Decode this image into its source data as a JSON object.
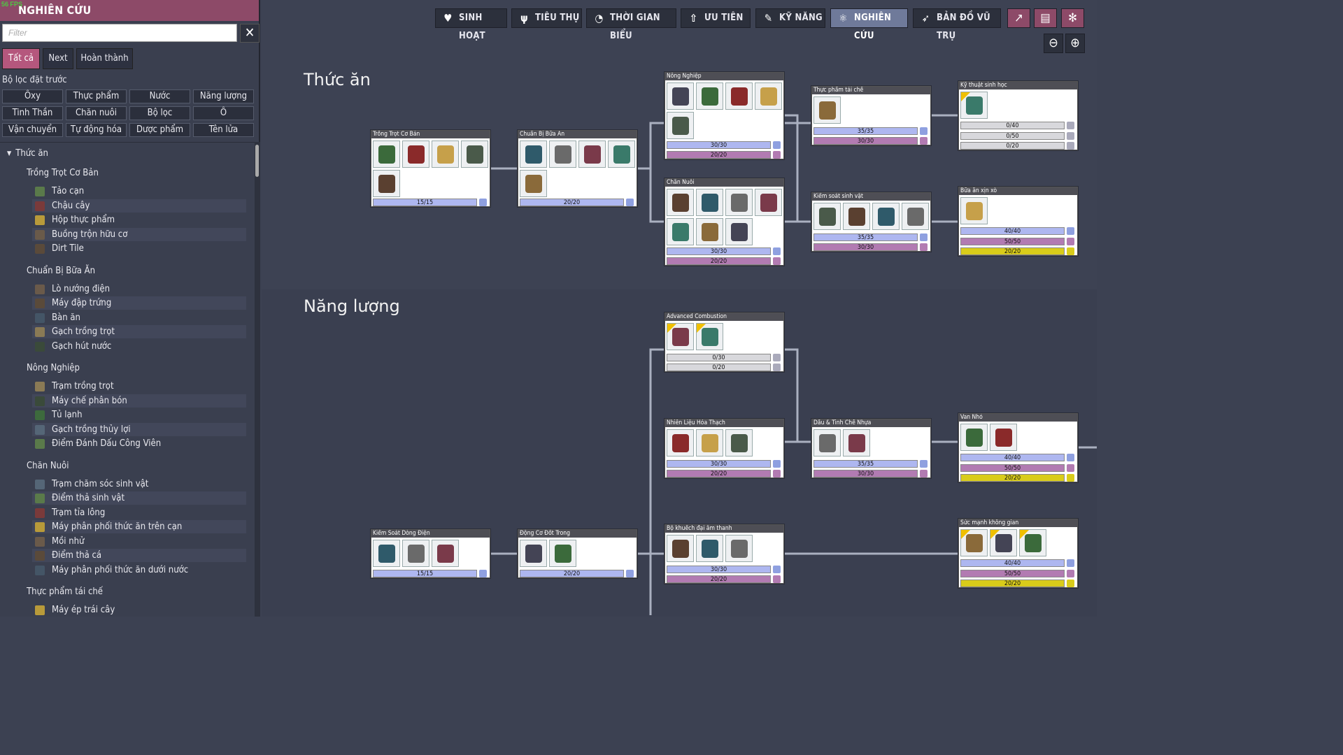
{
  "fps": "56 FPS",
  "sidebar": {
    "title": "NGHIÊN CỨU",
    "filter_placeholder": "Filter",
    "clear_label": "✕",
    "tabs": [
      "Tất cả",
      "Next",
      "Hoàn thành"
    ],
    "preset_label": "Bộ lọc đặt trước",
    "presets": [
      "Ôxy",
      "Thực phẩm",
      "Nước",
      "Năng lượng",
      "Tinh Thần",
      "Chăn nuôi",
      "Bộ lọc",
      "Ô",
      "Vận chuyển",
      "Tự động hóa",
      "Dược phẩm",
      "Tên lửa"
    ],
    "category": "Thức ăn",
    "groups": [
      {
        "name": "Trồng Trọt Cơ Bản",
        "items": [
          "Tảo cạn",
          "Chậu cây",
          "Hộp thực phẩm",
          "Buồng trộn hữu cơ",
          "Dirt Tile"
        ]
      },
      {
        "name": "Chuẩn Bị Bữa Ăn",
        "items": [
          "Lò nướng điện",
          "Máy đập trứng",
          "Bàn ăn",
          "Gạch trồng trọt",
          "Gạch hút nước"
        ]
      },
      {
        "name": "Nông Nghiệp",
        "items": [
          "Trạm trồng trọt",
          "Máy chế phân bón",
          "Tủ lạnh",
          "Gạch trồng thủy lợi",
          "Điểm Đánh Dấu Công Viên"
        ]
      },
      {
        "name": "Chăn Nuôi",
        "items": [
          "Trạm chăm sóc sinh vật",
          "Điểm thả sinh vật",
          "Trạm tỉa lông",
          "Máy phân phối thức ăn trên cạn",
          "Mồi nhử",
          "Điểm thả cá",
          "Máy phân phối thức ăn dưới nước"
        ]
      },
      {
        "name": "Thực phẩm tái chế",
        "items": [
          "Máy ép trái cây"
        ]
      }
    ]
  },
  "toolbar": {
    "buttons": [
      {
        "label": "SINH HOẠT",
        "icon": "heart-icon"
      },
      {
        "label": "TIÊU THỤ",
        "icon": "fork-knife-icon"
      },
      {
        "label": "THỜI GIAN BIỂU",
        "icon": "stopwatch-icon"
      },
      {
        "label": "ƯU TIÊN",
        "icon": "priority-arrow-icon"
      },
      {
        "label": "KỸ NĂNG",
        "icon": "wrench-icon"
      },
      {
        "label": "NGHIÊN CỨU",
        "icon": "research-atom-icon",
        "active": true
      },
      {
        "label": "BẢN ĐỒ VŨ TRỤ",
        "icon": "rocket-icon"
      }
    ],
    "icon_buttons": [
      "chart-icon",
      "book-icon",
      "gear-icon"
    ],
    "zoom": [
      "zoom-out-icon",
      "zoom-in-icon"
    ]
  },
  "sections": [
    "Thức ăn",
    "Năng lượng"
  ],
  "colors": {
    "accent": "#8d4a68",
    "bar_blue": "#aeb7f0",
    "bar_purple": "#b27bb2",
    "bar_yellow": "#d9cc1a"
  },
  "cards": [
    {
      "title": "Trồng Trọt Cơ Bản",
      "bars": [
        {
          "text": "15/15",
          "color": "blue"
        }
      ]
    },
    {
      "title": "Chuẩn Bị Bữa Ăn",
      "bars": [
        {
          "text": "20/20",
          "color": "blue"
        }
      ]
    },
    {
      "title": "Nông Nghiệp",
      "bars": [
        {
          "text": "30/30",
          "color": "blue"
        },
        {
          "text": "20/20",
          "color": "purple"
        }
      ]
    },
    {
      "title": "Chăn Nuôi",
      "bars": [
        {
          "text": "30/30",
          "color": "blue"
        },
        {
          "text": "20/20",
          "color": "purple"
        }
      ]
    },
    {
      "title": "Thực phẩm tái chế",
      "bars": [
        {
          "text": "35/35",
          "color": "blue"
        },
        {
          "text": "30/30",
          "color": "purple"
        }
      ]
    },
    {
      "title": "Kiểm soát sinh vật",
      "bars": [
        {
          "text": "35/35",
          "color": "blue"
        },
        {
          "text": "30/30",
          "color": "purple"
        }
      ]
    },
    {
      "title": "Kỹ thuật sinh học",
      "bars": [
        {
          "text": "0/40",
          "color": "grey"
        },
        {
          "text": "0/50",
          "color": "grey"
        },
        {
          "text": "0/20",
          "color": "grey"
        }
      ]
    },
    {
      "title": "Bữa ăn xịn xò",
      "bars": [
        {
          "text": "40/40",
          "color": "blue"
        },
        {
          "text": "50/50",
          "color": "purple"
        },
        {
          "text": "20/20",
          "color": "yellow"
        }
      ]
    },
    {
      "title": "Advanced Combustion",
      "bars": [
        {
          "text": "0/30",
          "color": "grey"
        },
        {
          "text": "0/20",
          "color": "grey"
        }
      ]
    },
    {
      "title": "Nhiên Liệu Hóa Thạch",
      "bars": [
        {
          "text": "30/30",
          "color": "blue"
        },
        {
          "text": "20/20",
          "color": "purple"
        }
      ]
    },
    {
      "title": "Dầu & Tinh Chế Nhựa",
      "bars": [
        {
          "text": "35/35",
          "color": "blue"
        },
        {
          "text": "30/30",
          "color": "purple"
        }
      ]
    },
    {
      "title": "Van Nhỏ",
      "bars": [
        {
          "text": "40/40",
          "color": "blue"
        },
        {
          "text": "50/50",
          "color": "purple"
        },
        {
          "text": "20/20",
          "color": "yellow"
        }
      ]
    },
    {
      "title": "Kiểm Soát Dòng Điện",
      "bars": [
        {
          "text": "15/15",
          "color": "blue"
        }
      ]
    },
    {
      "title": "Động Cơ Đốt Trong",
      "bars": [
        {
          "text": "20/20",
          "color": "blue"
        }
      ]
    },
    {
      "title": "Bộ khuếch đại âm thanh",
      "bars": [
        {
          "text": "30/30",
          "color": "blue"
        },
        {
          "text": "20/20",
          "color": "purple"
        }
      ]
    },
    {
      "title": "Sức mạnh không gian",
      "bars": [
        {
          "text": "40/40",
          "color": "blue"
        },
        {
          "text": "50/50",
          "color": "purple"
        },
        {
          "text": "20/20",
          "color": "yellow"
        }
      ]
    }
  ]
}
